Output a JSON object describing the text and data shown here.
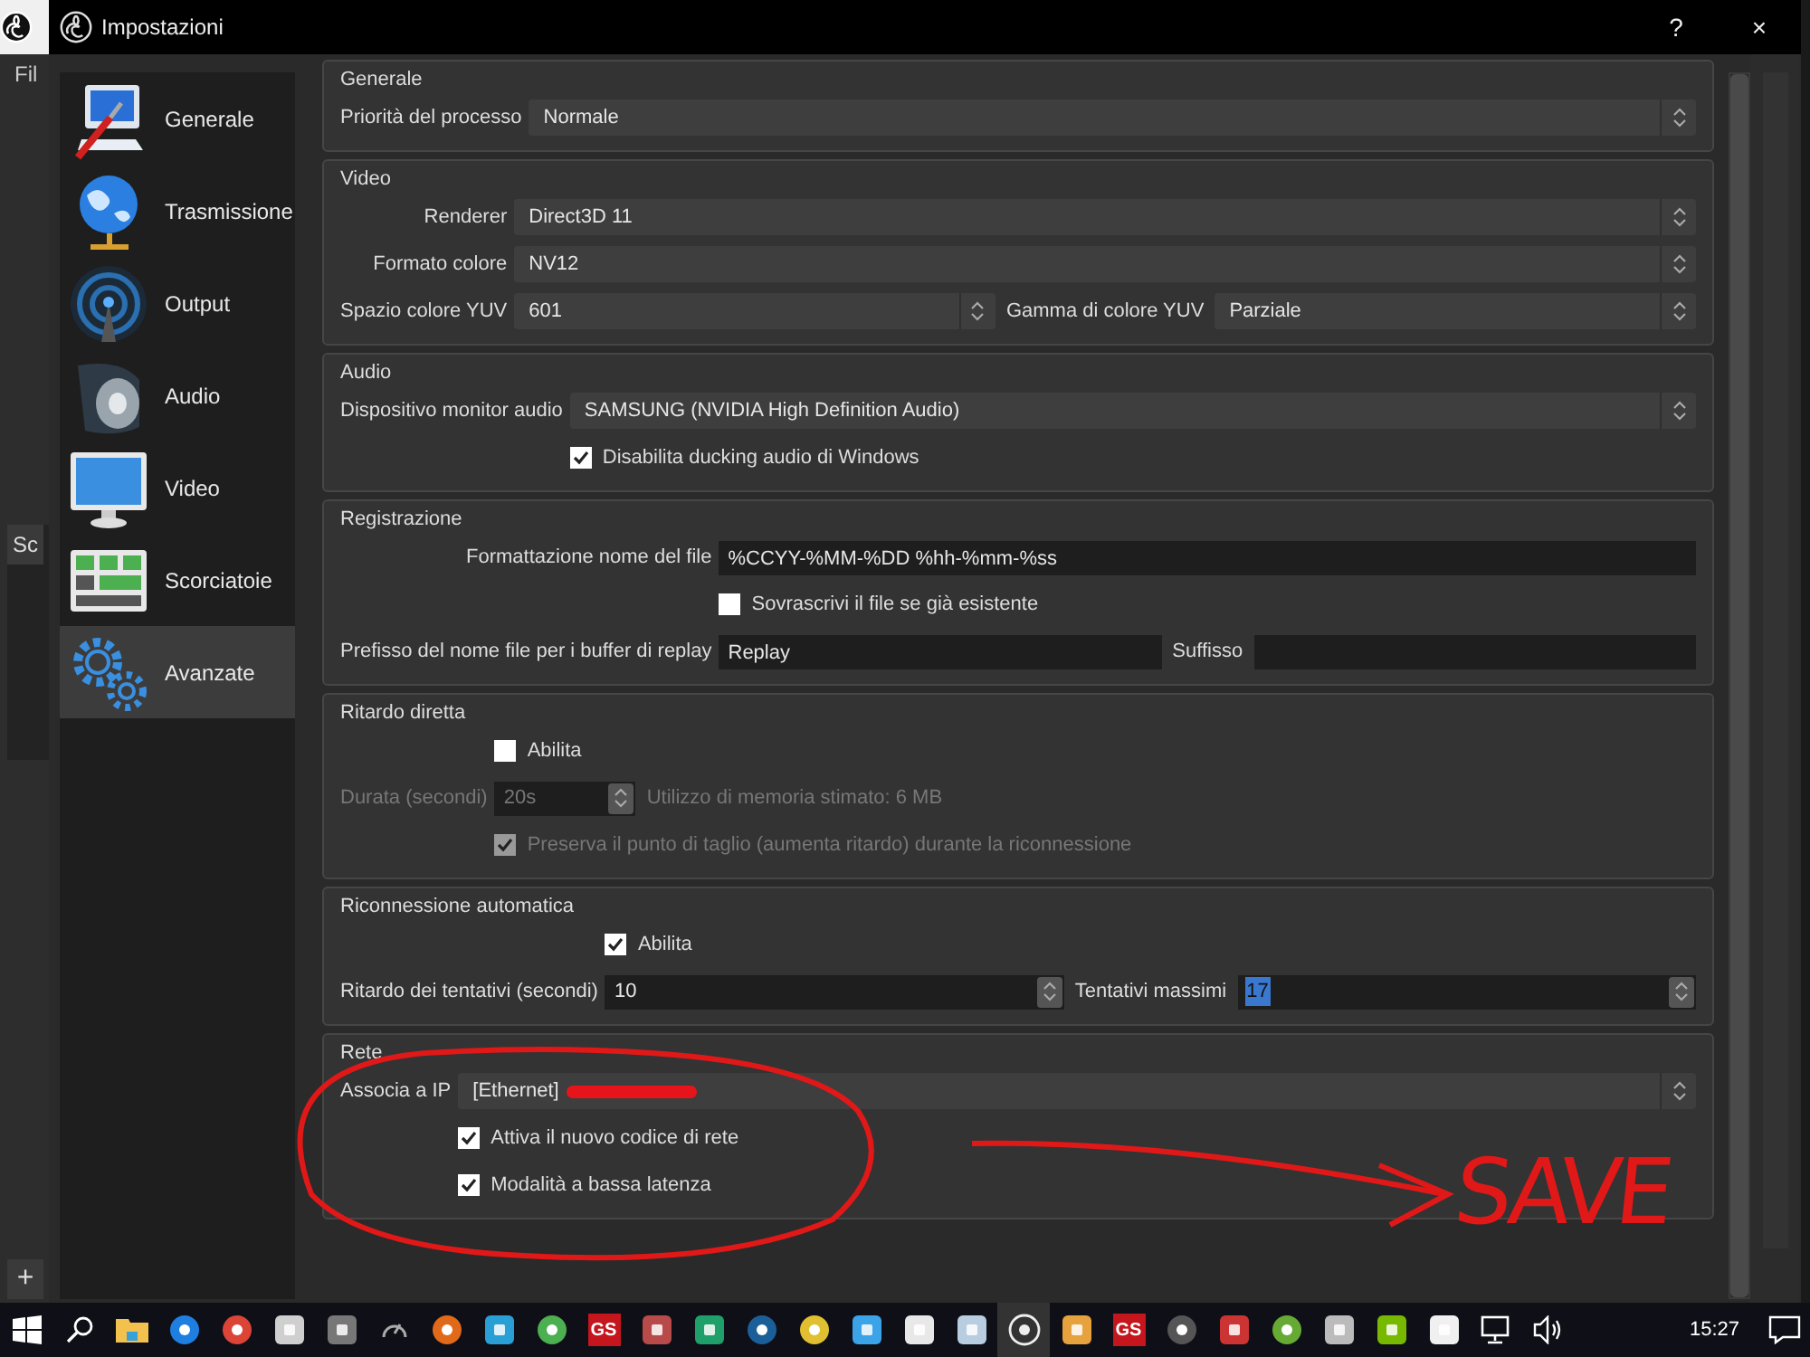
{
  "background": {
    "menu_text": "Fil",
    "panel_title": "Sc",
    "add_button": "+"
  },
  "window": {
    "title": "Impostazioni",
    "help_button": "?",
    "close_button": "×"
  },
  "sidebar": {
    "items": [
      {
        "label": "Generale",
        "selected": false
      },
      {
        "label": "Trasmissione",
        "selected": false
      },
      {
        "label": "Output",
        "selected": false
      },
      {
        "label": "Audio",
        "selected": false
      },
      {
        "label": "Video",
        "selected": false
      },
      {
        "label": "Scorciatoie",
        "selected": false
      },
      {
        "label": "Avanzate",
        "selected": true
      }
    ]
  },
  "groups": [
    {
      "title": "Generale",
      "rows": [
        {
          "label": "Priorità del processo",
          "disabled": false,
          "controls": [
            {
              "kind": "select",
              "value": "Normale"
            }
          ]
        }
      ]
    },
    {
      "title": "Video",
      "rows": [
        {
          "label": "Renderer",
          "disabled": false,
          "controls": [
            {
              "kind": "select",
              "value": "Direct3D 11"
            }
          ]
        },
        {
          "label": "Formato colore",
          "disabled": false,
          "controls": [
            {
              "kind": "select",
              "value": "NV12"
            }
          ]
        },
        {
          "label": "Spazio colore YUV",
          "disabled": false,
          "controls": [
            {
              "kind": "select",
              "value": "601"
            },
            {
              "kind": "label",
              "text": "Gamma di colore YUV"
            },
            {
              "kind": "select",
              "value": "Parziale"
            }
          ]
        }
      ]
    },
    {
      "title": "Audio",
      "rows": [
        {
          "label": "Dispositivo monitor audio",
          "disabled": false,
          "controls": [
            {
              "kind": "select",
              "value": "SAMSUNG (NVIDIA High Definition Audio)"
            }
          ]
        },
        {
          "disabled": false,
          "controls": [
            {
              "kind": "checkbox",
              "text": "Disabilita ducking audio di Windows",
              "checked": true
            }
          ]
        }
      ]
    },
    {
      "title": "Registrazione",
      "rows": [
        {
          "label": "Formattazione nome del file",
          "disabled": false,
          "controls": [
            {
              "kind": "text",
              "value": "%CCYY-%MM-%DD %hh-%mm-%ss"
            }
          ]
        },
        {
          "disabled": false,
          "controls": [
            {
              "kind": "checkbox",
              "text": "Sovrascrivi il file se già esistente",
              "checked": false
            }
          ]
        },
        {
          "label": "Prefisso del nome file per i buffer di replay",
          "disabled": false,
          "controls": [
            {
              "kind": "text",
              "value": "Replay"
            },
            {
              "kind": "label",
              "text": "Suffisso"
            },
            {
              "kind": "text"
            }
          ]
        }
      ]
    },
    {
      "title": "Ritardo diretta",
      "rows": [
        {
          "disabled": false,
          "controls": [
            {
              "kind": "checkbox",
              "text": "Abilita",
              "checked": false
            }
          ]
        },
        {
          "label": "Durata (secondi)",
          "disabled": true,
          "controls": [
            {
              "kind": "spin",
              "value": "20s",
              "text_selected": false
            },
            {
              "kind": "note",
              "text": "Utilizzo di memoria stimato: 6 MB"
            }
          ]
        },
        {
          "disabled": true,
          "controls": [
            {
              "kind": "checkbox",
              "text": "Preserva il punto di taglio (aumenta ritardo) durante la riconnessione",
              "checked": true
            }
          ]
        }
      ]
    },
    {
      "title": "Riconnessione automatica",
      "rows": [
        {
          "disabled": false,
          "controls": [
            {
              "kind": "checkbox",
              "text": "Abilita",
              "checked": true
            }
          ]
        },
        {
          "label": "Ritardo dei tentativi (secondi)",
          "disabled": false,
          "controls": [
            {
              "kind": "spin",
              "value": "10",
              "text_selected": false
            },
            {
              "kind": "label",
              "text": "Tentativi massimi"
            },
            {
              "kind": "spin",
              "value": "17",
              "text_selected": true
            }
          ]
        }
      ]
    },
    {
      "title": "Rete",
      "rows": [
        {
          "label": "Associa a IP",
          "disabled": false,
          "controls": [
            {
              "kind": "select",
              "value": "[Ethernet]",
              "redacted": true
            }
          ]
        },
        {
          "disabled": false,
          "controls": [
            {
              "kind": "checkbox",
              "text": "Attiva il nuovo codice di rete",
              "checked": true
            }
          ]
        },
        {
          "disabled": false,
          "controls": [
            {
              "kind": "checkbox",
              "text": "Modalità a bassa latenza",
              "checked": true
            }
          ]
        }
      ]
    }
  ],
  "annotation": {
    "text": "SAVE"
  },
  "taskbar": {
    "badges": [
      "GS",
      "GS"
    ],
    "time": "15:27"
  }
}
